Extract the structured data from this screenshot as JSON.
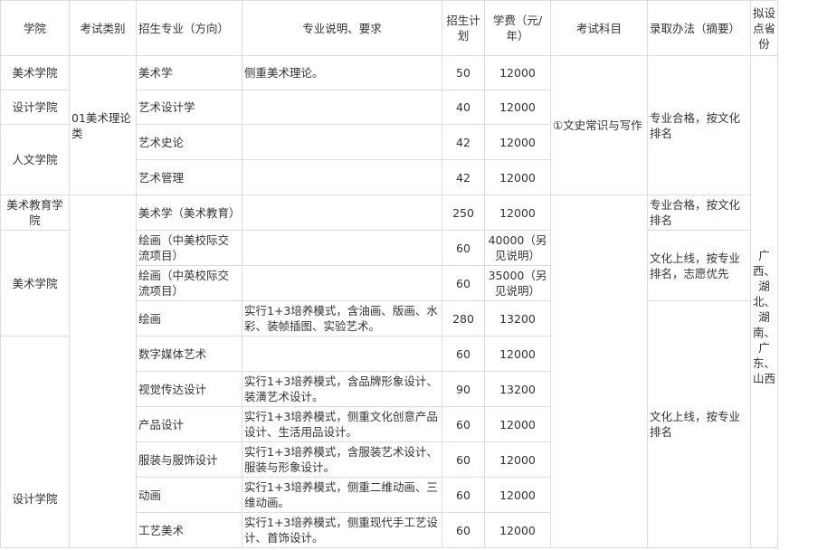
{
  "headers": {
    "college": "学院",
    "exam_type": "考试类别",
    "major": "招生专业（方向）",
    "desc": "专业说明、要求",
    "plan": "招生计划",
    "fee": "学费（元/年）",
    "subjects": "考试科目",
    "admission": "录取办法（摘要）",
    "province": "拟设点省份"
  },
  "colleges": {
    "meishu1": "美术学院",
    "sheji1": "设计学院",
    "renwen": "人文学院",
    "meijiao": "美术教育学院",
    "meishu2": "美术学院",
    "sheji2": "设计学院"
  },
  "exam_type_1": "01美术理论类",
  "subjects_1": "①文史常识与写作",
  "admission": {
    "a1": "专业合格，按文化排名",
    "a2": "专业合格，按文化排名",
    "a3": "文化上线，按专业排名，志愿优先",
    "a4": "文化上线，按专业排名"
  },
  "province_text": "广西、湖北、湖南、广东、山西",
  "rows": [
    {
      "major": "美术学",
      "desc": "侧重美术理论。",
      "plan": "50",
      "fee": "12000"
    },
    {
      "major": "艺术设计学",
      "desc": "",
      "plan": "40",
      "fee": "12000"
    },
    {
      "major": "艺术史论",
      "desc": "",
      "plan": "42",
      "fee": "12000"
    },
    {
      "major": "艺术管理",
      "desc": "",
      "plan": "42",
      "fee": "12000"
    },
    {
      "major": "美术学（美术教育）",
      "desc": "",
      "plan": "250",
      "fee": "12000"
    },
    {
      "major": "绘画（中美校际交流项目）",
      "desc": "",
      "plan": "60",
      "fee": "40000（另见说明）"
    },
    {
      "major": "绘画（中英校际交流项目）",
      "desc": "",
      "plan": "60",
      "fee": "35000（另见说明）"
    },
    {
      "major": "绘画",
      "desc": "实行1+3培养模式，含油画、版画、水彩、装帧插图、实验艺术。",
      "plan": "280",
      "fee": "13200"
    },
    {
      "major": "数字媒体艺术",
      "desc": "",
      "plan": "60",
      "fee": "12000"
    },
    {
      "major": "视觉传达设计",
      "desc": "实行1+3培养模式，含品牌形象设计、装潢艺术设计。",
      "plan": "90",
      "fee": "13200"
    },
    {
      "major": "产品设计",
      "desc": "实行1+3培养模式，侧重文化创意产品设计、生活用品设计。",
      "plan": "60",
      "fee": "12000"
    },
    {
      "major": "服装与服饰设计",
      "desc": "实行1+3培养模式，含服装艺术设计、服装与形象设计。",
      "plan": "60",
      "fee": "12000"
    },
    {
      "major": "动画",
      "desc": "实行1+3培养模式，侧重二维动画、三维动画。",
      "plan": "60",
      "fee": "12000"
    },
    {
      "major": "工艺美术",
      "desc": "实行1+3培养模式，侧重现代手工艺设计、首饰设计。",
      "plan": "60",
      "fee": "12000"
    }
  ]
}
